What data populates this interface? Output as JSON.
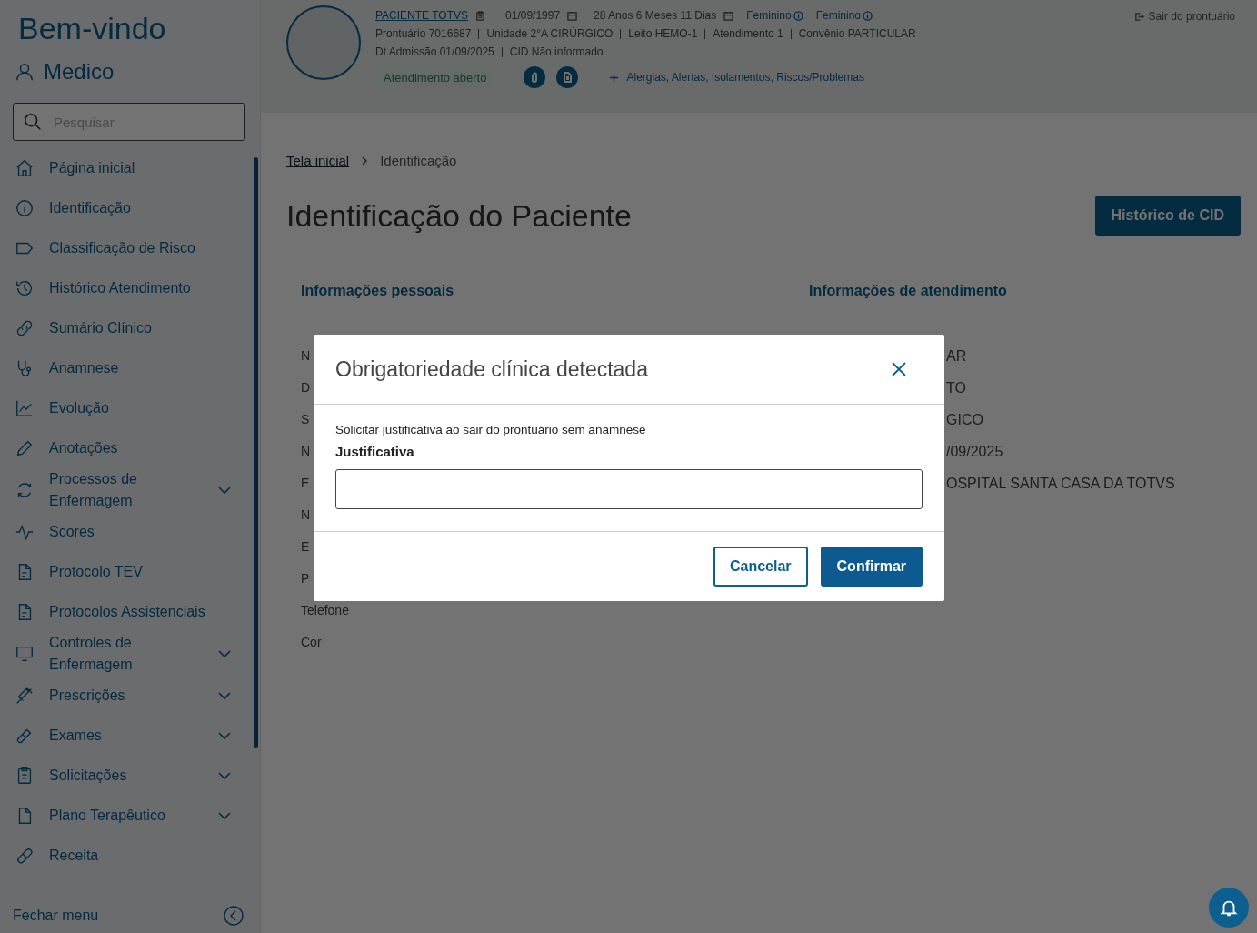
{
  "sidebar": {
    "greeting": "Bem-vindo",
    "user": "Medico",
    "search": {
      "placeholder": "Pesquisar"
    },
    "items": [
      {
        "label": "Página inicial",
        "has_submenu": false
      },
      {
        "label": "Identificação",
        "has_submenu": false
      },
      {
        "label": "Classificação de Risco",
        "has_submenu": false
      },
      {
        "label": "Histórico Atendimento",
        "has_submenu": false
      },
      {
        "label": "Sumário Clínico",
        "has_submenu": false
      },
      {
        "label": "Anamnese",
        "has_submenu": false
      },
      {
        "label": "Evolução",
        "has_submenu": false
      },
      {
        "label": "Anotações",
        "has_submenu": false
      },
      {
        "label": "Processos de Enfermagem",
        "has_submenu": true
      },
      {
        "label": "Scores",
        "has_submenu": false
      },
      {
        "label": "Protocolo TEV",
        "has_submenu": false
      },
      {
        "label": "Protocolos Assistenciais",
        "has_submenu": false
      },
      {
        "label": "Controles de Enfermagem",
        "has_submenu": true
      },
      {
        "label": "Prescrições",
        "has_submenu": true
      },
      {
        "label": "Exames",
        "has_submenu": true
      },
      {
        "label": "Solicitações",
        "has_submenu": true
      },
      {
        "label": "Plano Terapêutico",
        "has_submenu": true
      },
      {
        "label": "Receita",
        "has_submenu": false
      }
    ],
    "footer": "Fechar menu"
  },
  "patient_header": {
    "name": "PACIENTE TOTVS",
    "birth_date": "01/09/1997",
    "age": "28 Anos 6 Meses 11 Dias",
    "sex": [
      "Feminino",
      "Feminino"
    ],
    "details": [
      "Prontuário 7016687",
      "Unidade 2°A CIRÚRGICO",
      "Leito HEMO-1",
      "Atendimento 1",
      "Convênio PARTICULAR"
    ],
    "admission": [
      "Dt Admissão 01/09/2025",
      "CID Não informado"
    ],
    "status": "Atendimento aberto",
    "alerts_link": "Alergias, Alertas, Isolamentos, Riscos/Problemas",
    "exit": "Sair do prontuário"
  },
  "breadcrumb": [
    {
      "label": "Tela inicial",
      "link": true
    },
    {
      "label": "Identificação",
      "link": false
    }
  ],
  "page_title": "Identificação do Paciente",
  "cid_button": "Histórico de CID",
  "personal_info": {
    "title": "Informações pessoais",
    "labels": [
      "N",
      "D",
      "S",
      "N",
      "E",
      "N",
      "E",
      "P",
      "Telefone",
      "Cor"
    ]
  },
  "attendance_info": {
    "title": "Informações de atendimento",
    "values": [
      "AR",
      "TO",
      "GICO",
      "/09/2025",
      "OSPITAL SANTA CASA DA TOTVS"
    ]
  },
  "dialog": {
    "title": "Obrigatoriedade clínica detectada",
    "message": "Solicitar justificativa ao sair do prontuário sem anamnese",
    "field_label": "Justificativa",
    "buttons": [
      "Cancelar",
      "Confirmar"
    ]
  }
}
